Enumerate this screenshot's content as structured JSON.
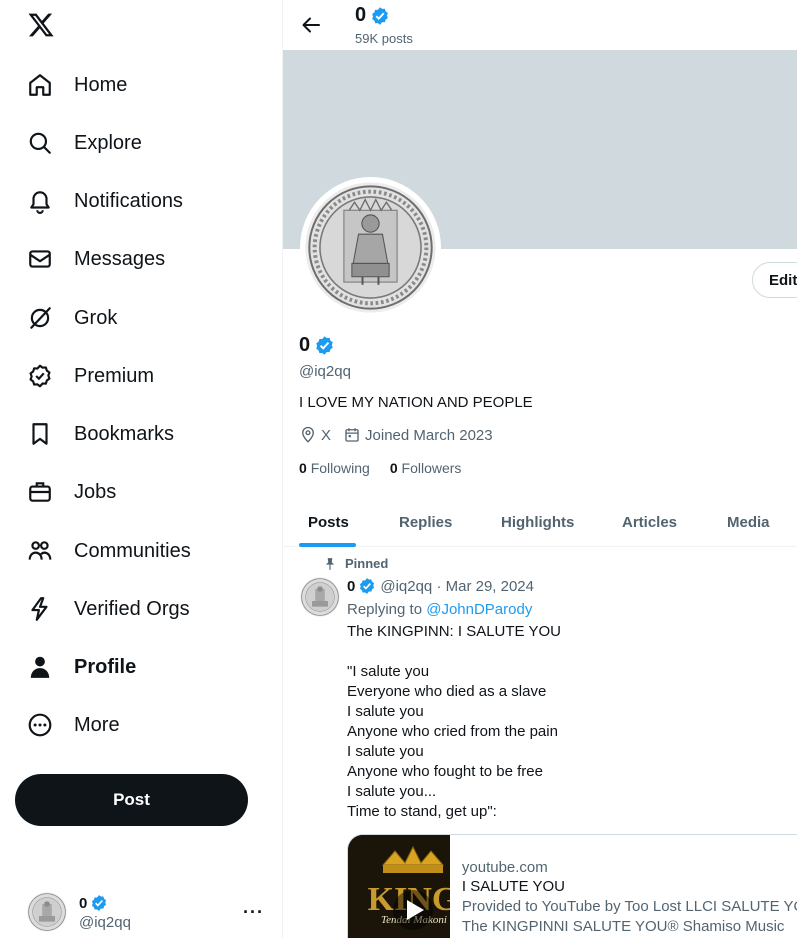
{
  "sidebar": {
    "items": [
      {
        "label": "Home",
        "icon": "home-icon"
      },
      {
        "label": "Explore",
        "icon": "search-icon"
      },
      {
        "label": "Notifications",
        "icon": "bell-icon"
      },
      {
        "label": "Messages",
        "icon": "envelope-icon"
      },
      {
        "label": "Grok",
        "icon": "grok-icon"
      },
      {
        "label": "Premium",
        "icon": "premium-badge-icon"
      },
      {
        "label": "Bookmarks",
        "icon": "bookmark-icon"
      },
      {
        "label": "Jobs",
        "icon": "briefcase-icon"
      },
      {
        "label": "Communities",
        "icon": "communities-icon"
      },
      {
        "label": "Verified Orgs",
        "icon": "lightning-icon"
      },
      {
        "label": "Profile",
        "icon": "person-icon"
      },
      {
        "label": "More",
        "icon": "more-circle-icon"
      }
    ],
    "post_label": "Post",
    "account": {
      "name": "0",
      "handle": "@iq2qq"
    }
  },
  "header": {
    "name": "0",
    "post_count": "59K posts"
  },
  "profile": {
    "edit_label": "Edit",
    "name": "0",
    "handle": "@iq2qq",
    "bio": "I LOVE MY NATION AND PEOPLE",
    "location": "X",
    "joined": "Joined March 2023",
    "following_count": "0",
    "following_label": "Following",
    "followers_count": "0",
    "followers_label": "Followers"
  },
  "tabs": [
    "Posts",
    "Replies",
    "Highlights",
    "Articles",
    "Media"
  ],
  "tweet": {
    "pinned_label": "Pinned",
    "name": "0",
    "handle_date": "@iq2qq · Mar 29, 2024",
    "replying_prefix": "Replying to",
    "replying_to": "@JohnDParody",
    "lines": [
      "The KINGPINN: I SALUTE YOU",
      "",
      "\"I salute you",
      "Everyone who died as a slave",
      "I salute you",
      "Anyone who cried from the pain",
      "I salute you",
      "Anyone who fought to be free",
      "I salute you...",
      "Time to stand, get up\":"
    ],
    "card": {
      "domain": "youtube.com",
      "title": "I SALUTE YOU",
      "desc1": "Provided to YouTube by Too Lost LLCI SALUTE YOU",
      "desc2": "The KINGPINNI SALUTE YOU® Shamiso Music",
      "thumb_text": "KING",
      "thumb_sub": "Tendai Makoni"
    }
  },
  "colors": {
    "accent": "#1d9bf0",
    "text": "#0f1419",
    "muted": "#536471",
    "banner": "#cfd9de"
  }
}
